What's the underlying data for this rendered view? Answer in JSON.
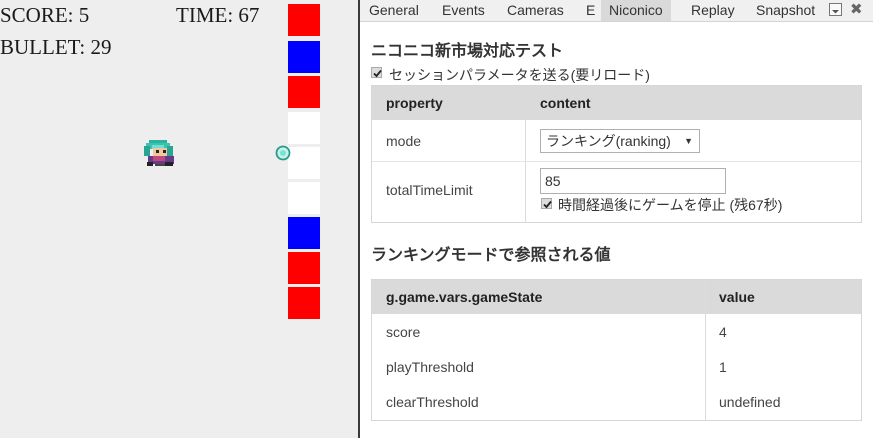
{
  "game": {
    "score_text": "SCORE: 5",
    "time_text": "TIME: 67",
    "bullet_text": "BULLET: 29",
    "block_colors": [
      "red",
      "blue",
      "red",
      "white",
      "white",
      "white",
      "blue",
      "red",
      "red"
    ],
    "colors": {
      "red": "#ff0000",
      "blue": "#0000ff",
      "white": "#ffffff",
      "background": "#eeeeee"
    }
  },
  "tabs": [
    {
      "label": "General",
      "active": false
    },
    {
      "label": "Events",
      "active": false
    },
    {
      "label": "Cameras",
      "active": false
    },
    {
      "label": "E",
      "active": false
    },
    {
      "label": "Niconico",
      "active": true
    },
    {
      "label": "Replay",
      "active": false
    },
    {
      "label": "Snapshot",
      "active": false
    }
  ],
  "panel": {
    "title": "ニコニコ新市場対応テスト",
    "session_param_label": "セッションパラメータを送る(要リロード)",
    "session_param_checked": true,
    "params_table": {
      "headers": [
        "property",
        "content"
      ],
      "mode_label": "mode",
      "mode_value": "ランキング(ranking)",
      "time_limit_label": "totalTimeLimit",
      "time_limit_value": "85",
      "stop_game_label": "時間経過後にゲームを停止 (残67秒)",
      "stop_game_checked": true
    },
    "ranking_heading": "ランキングモードで参照される値",
    "state_table": {
      "headers": [
        "g.game.vars.gameState",
        "value"
      ],
      "rows": [
        {
          "key": "score",
          "value": "4"
        },
        {
          "key": "playThreshold",
          "value": "1"
        },
        {
          "key": "clearThreshold",
          "value": "undefined"
        }
      ]
    }
  }
}
